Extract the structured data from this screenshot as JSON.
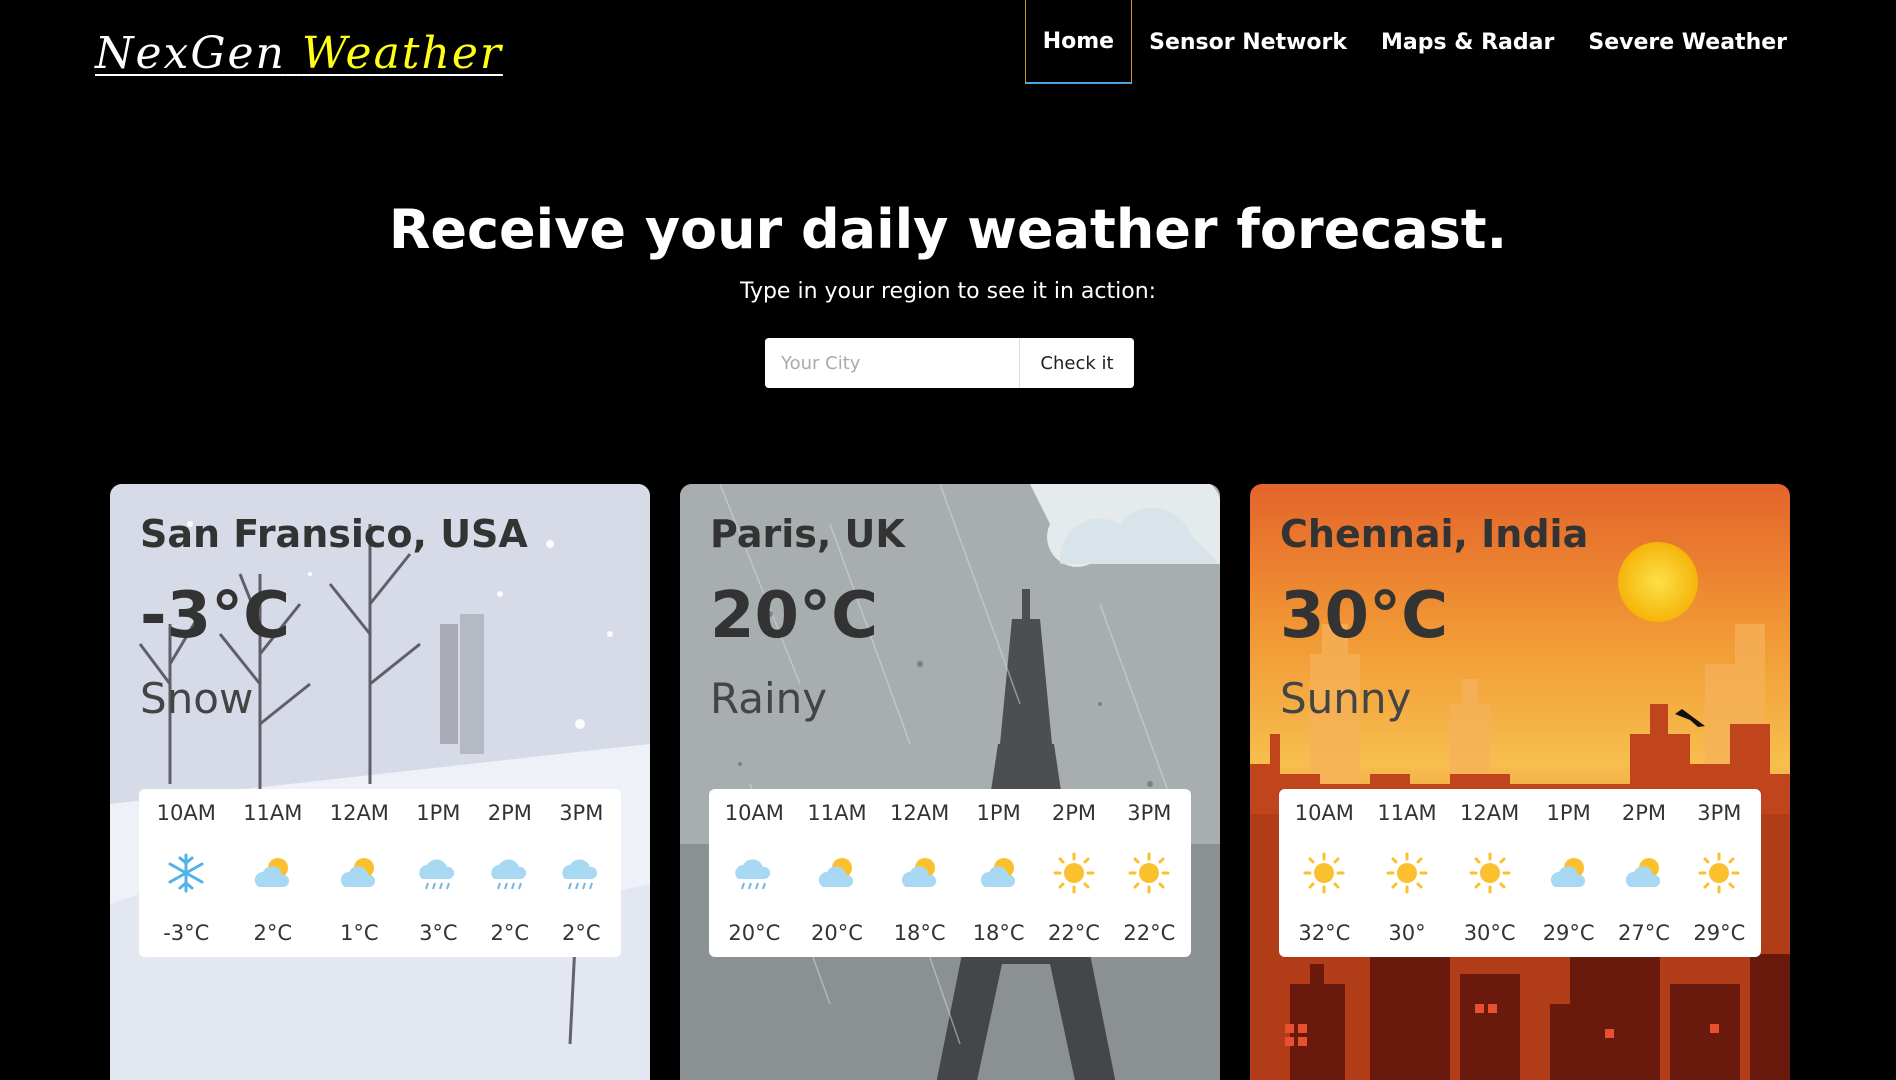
{
  "header": {
    "logo_part1": "NexGen",
    "logo_part2": "Weather",
    "nav": [
      "Home",
      "Sensor Network",
      "Maps & Radar",
      "Severe Weather"
    ]
  },
  "hero": {
    "title": "Receive your daily weather forecast.",
    "subtitle": "Type in your region to see it in action:",
    "search_placeholder": "Your City",
    "search_button": "Check it"
  },
  "cards": [
    {
      "city": "San Fransico, USA",
      "temp": "-3°C",
      "condition": "Snow",
      "hours": [
        {
          "time": "10AM",
          "icon": "snowflake-icon",
          "temp": "-3°C"
        },
        {
          "time": "11AM",
          "icon": "partly-cloudy-icon",
          "temp": "2°C"
        },
        {
          "time": "12AM",
          "icon": "partly-cloudy-icon",
          "temp": "1°C"
        },
        {
          "time": "1PM",
          "icon": "rain-cloud-icon",
          "temp": "3°C"
        },
        {
          "time": "2PM",
          "icon": "rain-cloud-icon",
          "temp": "2°C"
        },
        {
          "time": "3PM",
          "icon": "rain-cloud-icon",
          "temp": "2°C"
        }
      ]
    },
    {
      "city": "Paris, UK",
      "temp": "20°C",
      "condition": "Rainy",
      "hours": [
        {
          "time": "10AM",
          "icon": "rain-cloud-icon",
          "temp": "20°C"
        },
        {
          "time": "11AM",
          "icon": "partly-cloudy-icon",
          "temp": "20°C"
        },
        {
          "time": "12AM",
          "icon": "partly-cloudy-icon",
          "temp": "18°C"
        },
        {
          "time": "1PM",
          "icon": "partly-cloudy-icon",
          "temp": "18°C"
        },
        {
          "time": "2PM",
          "icon": "sun-icon",
          "temp": "22°C"
        },
        {
          "time": "3PM",
          "icon": "sun-icon",
          "temp": "22°C"
        }
      ]
    },
    {
      "city": "Chennai, India",
      "temp": "30°C",
      "condition": "Sunny",
      "hours": [
        {
          "time": "10AM",
          "icon": "sun-icon",
          "temp": "32°C"
        },
        {
          "time": "11AM",
          "icon": "sun-icon",
          "temp": "30°"
        },
        {
          "time": "12AM",
          "icon": "sun-icon",
          "temp": "30°C"
        },
        {
          "time": "1PM",
          "icon": "partly-cloudy-icon",
          "temp": "29°C"
        },
        {
          "time": "2PM",
          "icon": "partly-cloudy-icon",
          "temp": "27°C"
        },
        {
          "time": "3PM",
          "icon": "sun-icon",
          "temp": "29°C"
        }
      ]
    }
  ],
  "colors": {
    "background": "#000000",
    "logo_accent": "#ffff1a",
    "active_nav_underline": "#4aa6e0",
    "sun": "#fbc02d"
  }
}
